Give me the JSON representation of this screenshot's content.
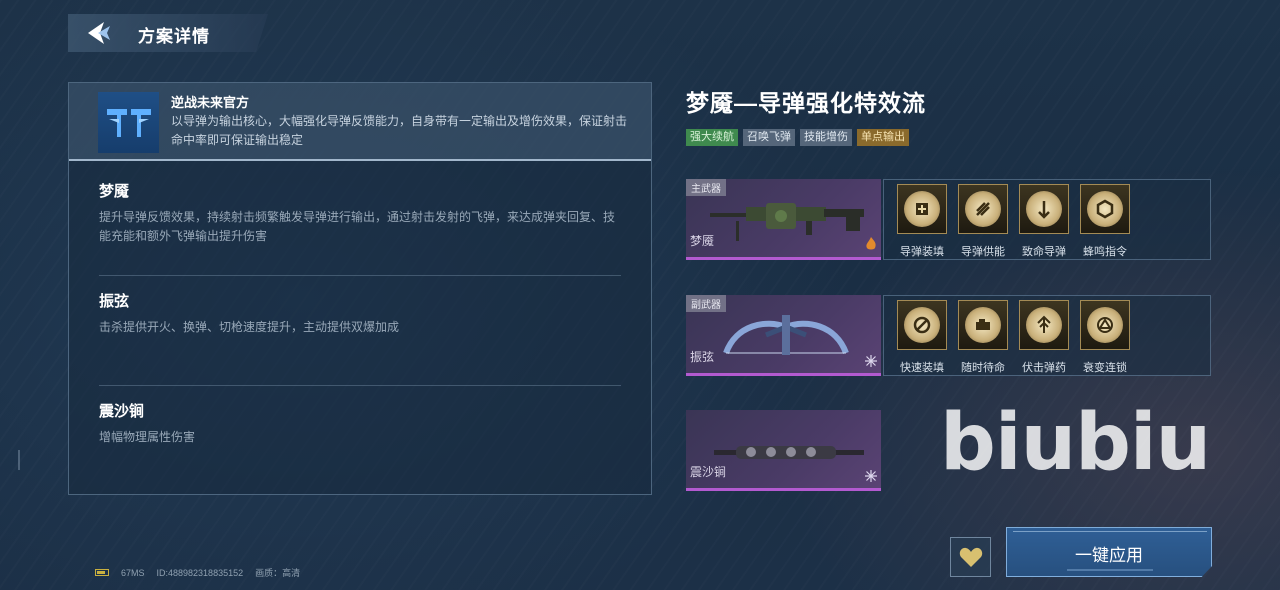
{
  "header": {
    "title": "方案详情",
    "back_icon": "back-arrow-icon"
  },
  "author": {
    "name": "逆战未来官方",
    "description": "以导弹为输出核心，大幅强化导弹反馈能力，自身带有一定输出及增伤效果，保证射击命中率即可保证输出稳定"
  },
  "sections": [
    {
      "title": "梦魇",
      "description": "提升导弹反馈效果，持续射击频繁触发导弹进行输出，通过射击发射的飞弹，来达成弹夹回复、技能充能和额外飞弹输出提升伤害"
    },
    {
      "title": "振弦",
      "description": "击杀提供开火、换弹、切枪速度提升，主动提供双爆加成"
    },
    {
      "title": "震沙锏",
      "description": "增幅物理属性伤害"
    }
  ],
  "scheme": {
    "title": "梦魇—导弹强化特效流",
    "tags": [
      {
        "label": "强大续航",
        "color": "#3f8a4e"
      },
      {
        "label": "召唤飞弹",
        "color": "#55667a"
      },
      {
        "label": "技能增伤",
        "color": "#55667a"
      },
      {
        "label": "单点输出",
        "color": "#8a6a2c"
      }
    ]
  },
  "weapons": [
    {
      "slot": "主武器",
      "name": "梦魇",
      "corner_icon": "flame-icon",
      "skills": [
        {
          "name": "导弹装填",
          "icon": "missile-load-icon"
        },
        {
          "name": "导弹供能",
          "icon": "missile-energy-icon"
        },
        {
          "name": "致命导弹",
          "icon": "deadly-missile-icon"
        },
        {
          "name": "蜂鸣指令",
          "icon": "buzz-command-icon"
        }
      ]
    },
    {
      "slot": "副武器",
      "name": "振弦",
      "corner_icon": "snowflake-icon",
      "skills": [
        {
          "name": "快速装填",
          "icon": "quick-reload-icon"
        },
        {
          "name": "随时待命",
          "icon": "standby-icon"
        },
        {
          "name": "伏击弹药",
          "icon": "ambush-ammo-icon"
        },
        {
          "name": "衰变连锁",
          "icon": "decay-chain-icon"
        }
      ]
    },
    {
      "slot": "",
      "name": "震沙锏",
      "corner_icon": "snowflake-icon",
      "skills": []
    }
  ],
  "watermark": "biubiu",
  "footer": {
    "ping": "67MS",
    "id": "ID:488982318835152",
    "quality": "画质：高清"
  },
  "actions": {
    "apply_label": "一键应用",
    "favorite_icon": "heart-icon"
  }
}
